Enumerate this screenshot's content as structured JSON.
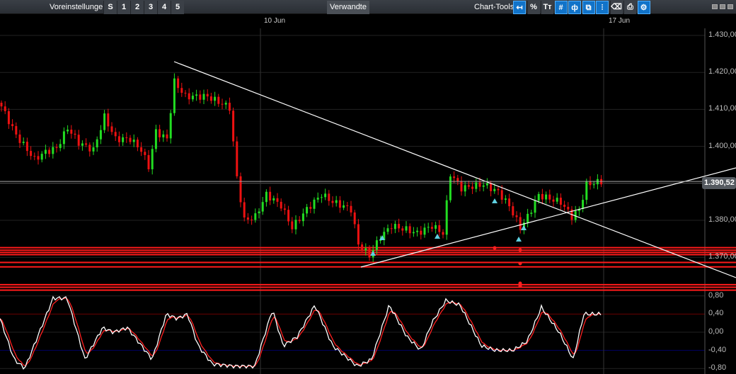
{
  "toolbar": {
    "presets_label": "Voreinstellungen",
    "preset_buttons": [
      "S",
      "1",
      "2",
      "3",
      "4",
      "5"
    ],
    "related_label": "Verwandte",
    "chart_tools_label": "Chart-Tools",
    "tools": [
      {
        "name": "back-icon",
        "glyph": "↤"
      },
      {
        "name": "percent-icon",
        "glyph": "%"
      },
      {
        "name": "text-size-icon",
        "glyph": "Tт"
      },
      {
        "name": "grid-icon",
        "glyph": "#"
      },
      {
        "name": "candle-icon",
        "glyph": "ф"
      },
      {
        "name": "overlay-icon",
        "glyph": "⧉"
      },
      {
        "name": "indicator-icon",
        "glyph": "⫶"
      },
      {
        "name": "label-icon",
        "glyph": "⌫"
      },
      {
        "name": "print-icon",
        "glyph": "⎙"
      },
      {
        "name": "settings-icon",
        "glyph": "⚙"
      }
    ]
  },
  "dates": [
    "10 Jun",
    "17 Jun"
  ],
  "price_axis": [
    "1.430,00",
    "1.420,00",
    "1.410,00",
    "1.400,00",
    "1.380,00",
    "1.370,00"
  ],
  "osc_axis": [
    "0,80",
    "0,40",
    "0,00",
    "-0,40",
    "-0,80"
  ],
  "last_price": "1.390,52",
  "chart_data": {
    "type": "candlestick",
    "ylim": [
      1364,
      1432
    ],
    "last": 1390.52,
    "price_keypoints": [
      [
        0,
        1410.8
      ],
      [
        4,
        1403
      ],
      [
        9,
        1396.5
      ],
      [
        12,
        1398.5
      ],
      [
        15,
        1399.5
      ],
      [
        18,
        1405
      ],
      [
        21,
        1401
      ],
      [
        25,
        1399
      ],
      [
        28,
        1408
      ],
      [
        31,
        1402
      ],
      [
        35,
        1402
      ],
      [
        38,
        1399
      ],
      [
        40,
        1394.5
      ],
      [
        42,
        1404
      ],
      [
        45,
        1402
      ],
      [
        47,
        1417.5
      ],
      [
        50,
        1413.5
      ],
      [
        56,
        1413.5
      ],
      [
        62,
        1410.5
      ],
      [
        64,
        1391.5
      ],
      [
        66,
        1380
      ],
      [
        69,
        1381
      ],
      [
        72,
        1387
      ],
      [
        76,
        1384
      ],
      [
        79,
        1378
      ],
      [
        83,
        1383
      ],
      [
        87,
        1387
      ],
      [
        90,
        1385
      ],
      [
        95,
        1383
      ],
      [
        97,
        1373.5
      ],
      [
        100,
        1370.5
      ],
      [
        103,
        1375.5
      ],
      [
        106,
        1378.5
      ],
      [
        110,
        1377.5
      ],
      [
        113,
        1376.5
      ],
      [
        117,
        1378.5
      ],
      [
        120,
        1376.5
      ],
      [
        122,
        1392.6
      ],
      [
        125,
        1388.7
      ],
      [
        131,
        1389.7
      ],
      [
        135,
        1387.7
      ],
      [
        138,
        1383.9
      ],
      [
        141,
        1378
      ],
      [
        143,
        1381
      ],
      [
        146,
        1386.8
      ],
      [
        152,
        1384.9
      ],
      [
        155,
        1381
      ],
      [
        157,
        1382.9
      ],
      [
        159,
        1389.7
      ],
      [
        163,
        1390.5
      ]
    ],
    "osc_keypoints": [
      [
        0,
        0.3
      ],
      [
        20,
        -0.6
      ],
      [
        35,
        -0.8
      ],
      [
        75,
        0.75
      ],
      [
        95,
        0.75
      ],
      [
        120,
        -0.6
      ],
      [
        145,
        0.1
      ],
      [
        160,
        0
      ],
      [
        180,
        0.1
      ],
      [
        200,
        -0.3
      ],
      [
        215,
        -0.6
      ],
      [
        235,
        0.4
      ],
      [
        250,
        0.3
      ],
      [
        265,
        0.4
      ],
      [
        280,
        -0.3
      ],
      [
        300,
        -0.7
      ],
      [
        330,
        -0.75
      ],
      [
        360,
        -0.75
      ],
      [
        385,
        0.5
      ],
      [
        400,
        -0.3
      ],
      [
        420,
        -0.1
      ],
      [
        445,
        0.6
      ],
      [
        470,
        -0.3
      ],
      [
        505,
        -0.75
      ],
      [
        525,
        -0.6
      ],
      [
        550,
        0.6
      ],
      [
        575,
        -0.1
      ],
      [
        595,
        -0.4
      ],
      [
        610,
        0.2
      ],
      [
        630,
        0.7
      ],
      [
        650,
        0.6
      ],
      [
        680,
        -0.3
      ],
      [
        700,
        -0.4
      ],
      [
        725,
        -0.4
      ],
      [
        745,
        -0.2
      ],
      [
        765,
        0.55
      ],
      [
        790,
        0
      ],
      [
        810,
        -0.6
      ],
      [
        825,
        0.4
      ],
      [
        850,
        0.4
      ]
    ],
    "support_levels": [
      1372.6,
      1371.9,
      1371.3,
      1370.7,
      1368.6,
      1367.4,
      1362.6,
      1361.9,
      1361.1
    ],
    "colors": {
      "up": "#22dd22",
      "down": "#ee1111",
      "marker": "#5fd0e0"
    }
  }
}
